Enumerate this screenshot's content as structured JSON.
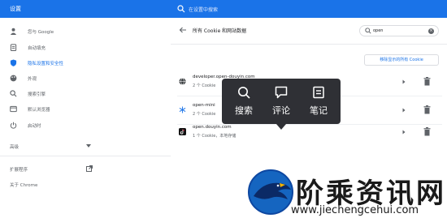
{
  "header": {
    "title": "设置",
    "search_placeholder": "在设置中搜索"
  },
  "sidebar": {
    "items": [
      {
        "label": "您与 Google",
        "icon": "person-icon"
      },
      {
        "label": "自动填充",
        "icon": "clipboard-icon"
      },
      {
        "label": "隐私设置和安全性",
        "icon": "shield-icon",
        "active": true
      },
      {
        "label": "外观",
        "icon": "palette-icon"
      },
      {
        "label": "搜索引擎",
        "icon": "search-icon"
      },
      {
        "label": "默认浏览器",
        "icon": "browser-icon"
      },
      {
        "label": "启动时",
        "icon": "power-icon"
      }
    ],
    "advanced_label": "高级",
    "extensions_label": "扩展程序",
    "about_label": "关于 Chrome"
  },
  "content": {
    "title": "所有 Cookie 和网站数据",
    "filter_value": "open",
    "remove_all_label": "移除显示的所有 Cookie",
    "rows": [
      {
        "domain": "developer.open-douyin.com",
        "detail": "2 个 Cookie"
      },
      {
        "domain": "open-mini",
        "detail": "2 个 Cookie"
      },
      {
        "domain": "open.douyin.com",
        "detail": "1 个 Cookie，本地存储"
      }
    ]
  },
  "popup": {
    "items": [
      {
        "label": "搜索",
        "icon": "search-icon"
      },
      {
        "label": "评论",
        "icon": "comment-icon"
      },
      {
        "label": "笔记",
        "icon": "note-icon"
      }
    ]
  },
  "watermark": {
    "title": "阶乘资讯网",
    "url": "www.jiechengcehui.com"
  },
  "colors": {
    "accent": "#1a73e8",
    "popup_bg": "#2f3035"
  }
}
